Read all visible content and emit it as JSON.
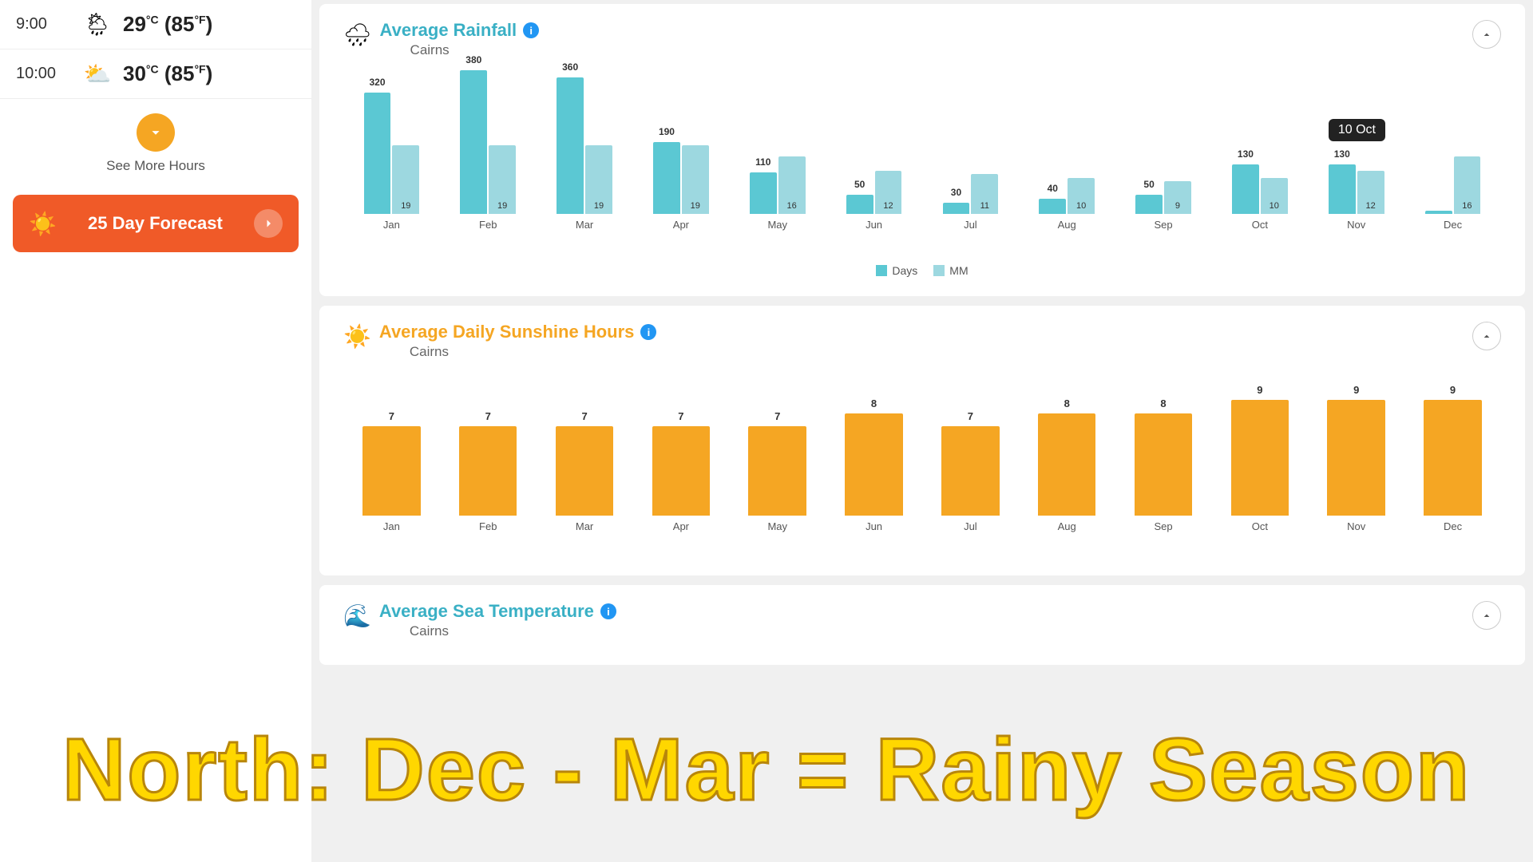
{
  "leftPanel": {
    "hours": [
      {
        "time": "9:00",
        "icon": "🌦",
        "tempC": "29",
        "tempF": "85"
      },
      {
        "time": "10:00",
        "icon": "⛅",
        "tempC": "30",
        "tempF": "85"
      }
    ],
    "seeMoreLabel": "See More Hours",
    "forecastLabel": "25 Day Forecast"
  },
  "rainfallCard": {
    "title": "Average Rainfall",
    "location": "Cairns",
    "iconType": "rain",
    "months": [
      "Jan",
      "Feb",
      "Mar",
      "Apr",
      "May",
      "Jun",
      "Jul",
      "Aug",
      "Sep",
      "Oct",
      "Nov",
      "Dec"
    ],
    "mmValues": [
      320,
      380,
      360,
      190,
      110,
      50,
      30,
      40,
      50,
      130,
      130,
      0
    ],
    "daysValues": [
      19,
      19,
      19,
      19,
      16,
      12,
      11,
      10,
      9,
      10,
      12,
      16
    ],
    "legend": {
      "daysLabel": "Days",
      "mmLabel": "MM"
    }
  },
  "sunshineCard": {
    "title": "Average Daily Sunshine Hours",
    "location": "Cairns",
    "iconType": "sun",
    "months": [
      "Jan",
      "Feb",
      "Mar",
      "Apr",
      "May",
      "Jun",
      "Jul",
      "Aug",
      "Sep",
      "Oct",
      "Nov",
      "Dec"
    ],
    "values": [
      7,
      7,
      7,
      7,
      7,
      8,
      7,
      8,
      8,
      9,
      9,
      9
    ]
  },
  "seaTempCard": {
    "title": "Average Sea Temperature",
    "location": "Cairns"
  },
  "overlayText": "North: Dec - Mar = Rainy Season",
  "octTooltip": "10 Oct"
}
